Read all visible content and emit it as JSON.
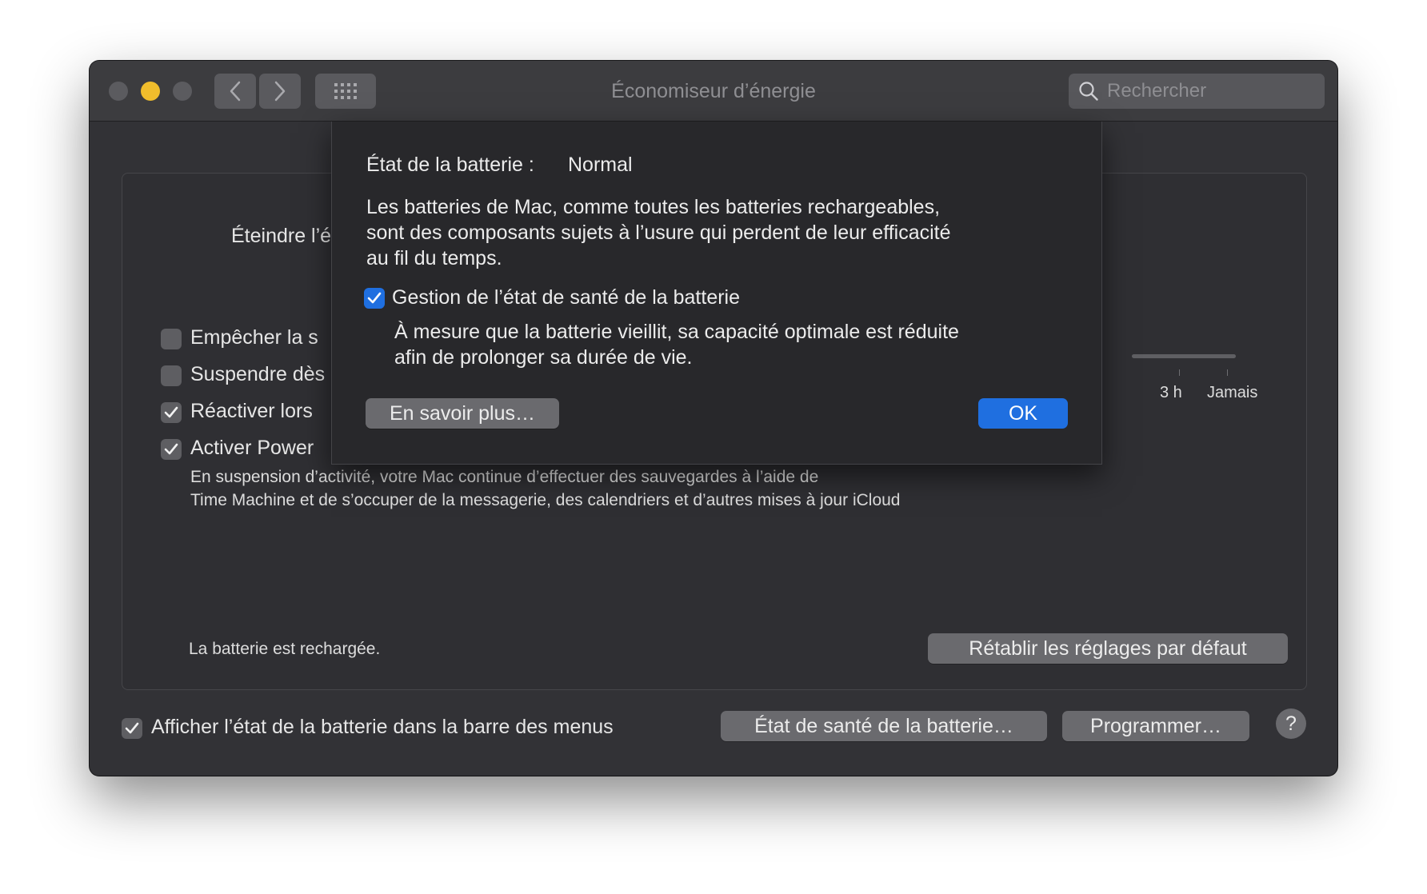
{
  "window": {
    "title": "Économiseur d’énergie"
  },
  "toolbar": {
    "search_placeholder": "Rechercher"
  },
  "main": {
    "turn_off_label": "Éteindre l’é",
    "slider_labels": [
      "3 h",
      "Jamais"
    ],
    "options": [
      {
        "label": "Empêcher la s",
        "checked": false
      },
      {
        "label": "Suspendre dès",
        "checked": false
      },
      {
        "label": "Réactiver lors",
        "checked": true
      },
      {
        "label": "Activer Power",
        "checked": true
      }
    ],
    "power_nap_desc_line1": "En suspension d’activité, votre Mac continue d’effectuer des sauvegardes à l’aide de",
    "power_nap_desc_line2": "Time Machine et de s’occuper de la messagerie, des calendriers et d’autres mises à jour iCloud",
    "battery_status_text": "La batterie est rechargée.",
    "restore_defaults_label": "Rétablir les réglages par défaut"
  },
  "footer": {
    "show_battery_label": "Afficher l’état de la batterie dans la barre des menus",
    "show_battery_checked": true,
    "battery_health_button": "État de santé de la batterie…",
    "schedule_button": "Programmer…",
    "help_label": "?"
  },
  "sheet": {
    "status_label": "État de la batterie :",
    "status_value": "Normal",
    "description_line1": "Les batteries de Mac, comme toutes les batteries rechargeables,",
    "description_line2": "sont des composants sujets à l’usure qui perdent de leur efficacité",
    "description_line3": "au fil du temps.",
    "management_label": "Gestion de l’état de santé de la batterie",
    "management_checked": true,
    "management_desc_line1": "À mesure que la batterie vieillit, sa capacité optimale est réduite",
    "management_desc_line2": "afin de prolonger sa durée de vie.",
    "learn_more_button": "En savoir plus…",
    "ok_button": "OK"
  }
}
